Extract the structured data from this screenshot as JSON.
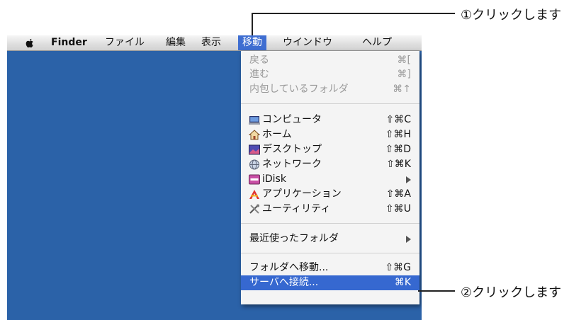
{
  "menubar": {
    "items": [
      "Finder",
      "ファイル",
      "編集",
      "表示",
      "移動",
      "ウインドウ",
      "ヘルプ"
    ]
  },
  "go_menu": {
    "items": [
      {
        "label": "戻る",
        "shortcut": "⌘[",
        "disabled": true
      },
      {
        "label": "進む",
        "shortcut": "⌘]",
        "disabled": true
      },
      {
        "label": "内包しているフォルダ",
        "shortcut": "⌘↑",
        "disabled": true
      },
      {
        "label": "コンピュータ",
        "shortcut": "⇧⌘C",
        "icon": "computer-icon"
      },
      {
        "label": "ホーム",
        "shortcut": "⇧⌘H",
        "icon": "home-icon"
      },
      {
        "label": "デスクトップ",
        "shortcut": "⇧⌘D",
        "icon": "desktop-icon"
      },
      {
        "label": "ネットワーク",
        "shortcut": "⇧⌘K",
        "icon": "network-icon"
      },
      {
        "label": "iDisk",
        "icon": "idisk-icon",
        "submenu": true
      },
      {
        "label": "アプリケーション",
        "shortcut": "⇧⌘A",
        "icon": "applications-icon"
      },
      {
        "label": "ユーティリティ",
        "shortcut": "⇧⌘U",
        "icon": "utilities-icon"
      },
      {
        "label": "最近使ったフォルダ",
        "submenu": true
      },
      {
        "label": "フォルダへ移動...",
        "shortcut": "⇧⌘G"
      },
      {
        "label": "サーバへ接続...",
        "shortcut": "⌘K",
        "highlighted": true
      }
    ]
  },
  "callouts": {
    "step1": "①クリックします",
    "step2": "②クリックします"
  },
  "colors": {
    "desktop": "#2b62a8",
    "highlight": "#3668d0"
  }
}
